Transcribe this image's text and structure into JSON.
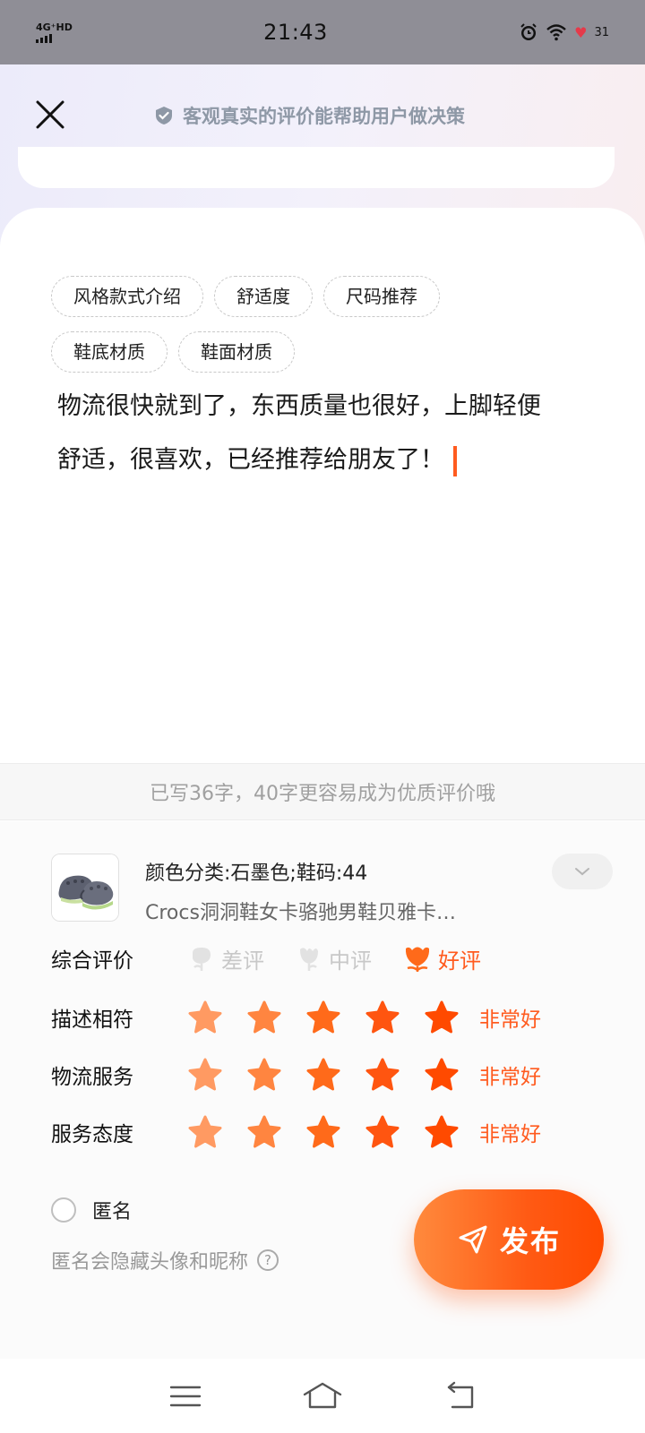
{
  "status_bar": {
    "network": "4G⁺HD",
    "time": "21:43",
    "battery": "31",
    "icons": [
      "signal-icon",
      "alarm-icon",
      "wifi-icon",
      "heart-icon",
      "battery-icon"
    ]
  },
  "header": {
    "close_icon": "close-icon",
    "hint": "客观真实的评价能帮助用户做决策",
    "hint_icon": "verified-shield-icon"
  },
  "tags": [
    "风格款式介绍",
    "舒适度",
    "尺码推荐",
    "鞋底材质",
    "鞋面材质"
  ],
  "review": {
    "line1": "物流很快就到了，东西质量也很好，上脚轻便",
    "line2": "舒适，很喜欢，已经推荐给朋友了！"
  },
  "count_hint": "已写36字，40字更容易成为优质评价哦",
  "product": {
    "spec": "颜色分类:石墨色;鞋码:44",
    "name": "Crocs洞洞鞋女卡骆驰男鞋贝雅卡…",
    "expand_icon": "chevron-down-icon"
  },
  "overall": {
    "label": "综合评价",
    "options": [
      {
        "label": "差评",
        "selected": false
      },
      {
        "label": "中评",
        "selected": false
      },
      {
        "label": "好评",
        "selected": true
      }
    ]
  },
  "ratings": [
    {
      "label": "描述相符",
      "stars": 5,
      "max": 5,
      "level": "非常好"
    },
    {
      "label": "物流服务",
      "stars": 5,
      "max": 5,
      "level": "非常好"
    },
    {
      "label": "服务态度",
      "stars": 5,
      "max": 5,
      "level": "非常好"
    }
  ],
  "anonymous": {
    "label": "匿名",
    "checked": false,
    "hint": "匿名会隐藏头像和昵称"
  },
  "publish": {
    "label": "发布",
    "icon": "send-icon"
  },
  "colors": {
    "accent": "#ff5b1f",
    "star_gradient": [
      "#ff9a62",
      "#ff8540",
      "#ff6a1a",
      "#ff5510",
      "#ff4a00"
    ]
  }
}
